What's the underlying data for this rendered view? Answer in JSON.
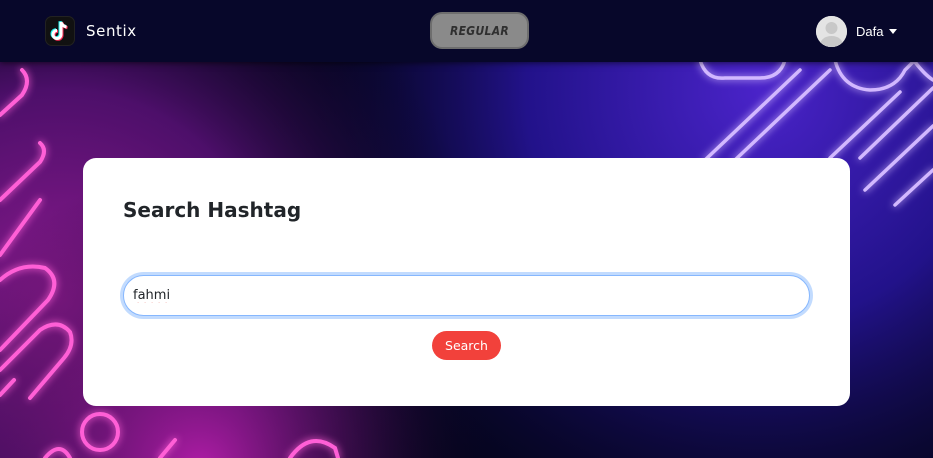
{
  "navbar": {
    "brand_name": "Sentix",
    "brand_icon": "tiktok-icon",
    "mode_label": "REGULAR",
    "user_name": "Dafa",
    "avatar_icon": "user-avatar-icon",
    "dropdown_icon": "caret-down-icon"
  },
  "main": {
    "title": "Search Hashtag",
    "search_value": "fahmi",
    "search_button_label": "Search"
  },
  "colors": {
    "navbar_bg": "#07072a",
    "accent_button": "#f2413b",
    "mode_button_bg": "#8a8a8a",
    "neon_pink": "#ff3cc7",
    "neon_violet": "#c5a6ff",
    "focus_ring": "#86b7fe"
  }
}
